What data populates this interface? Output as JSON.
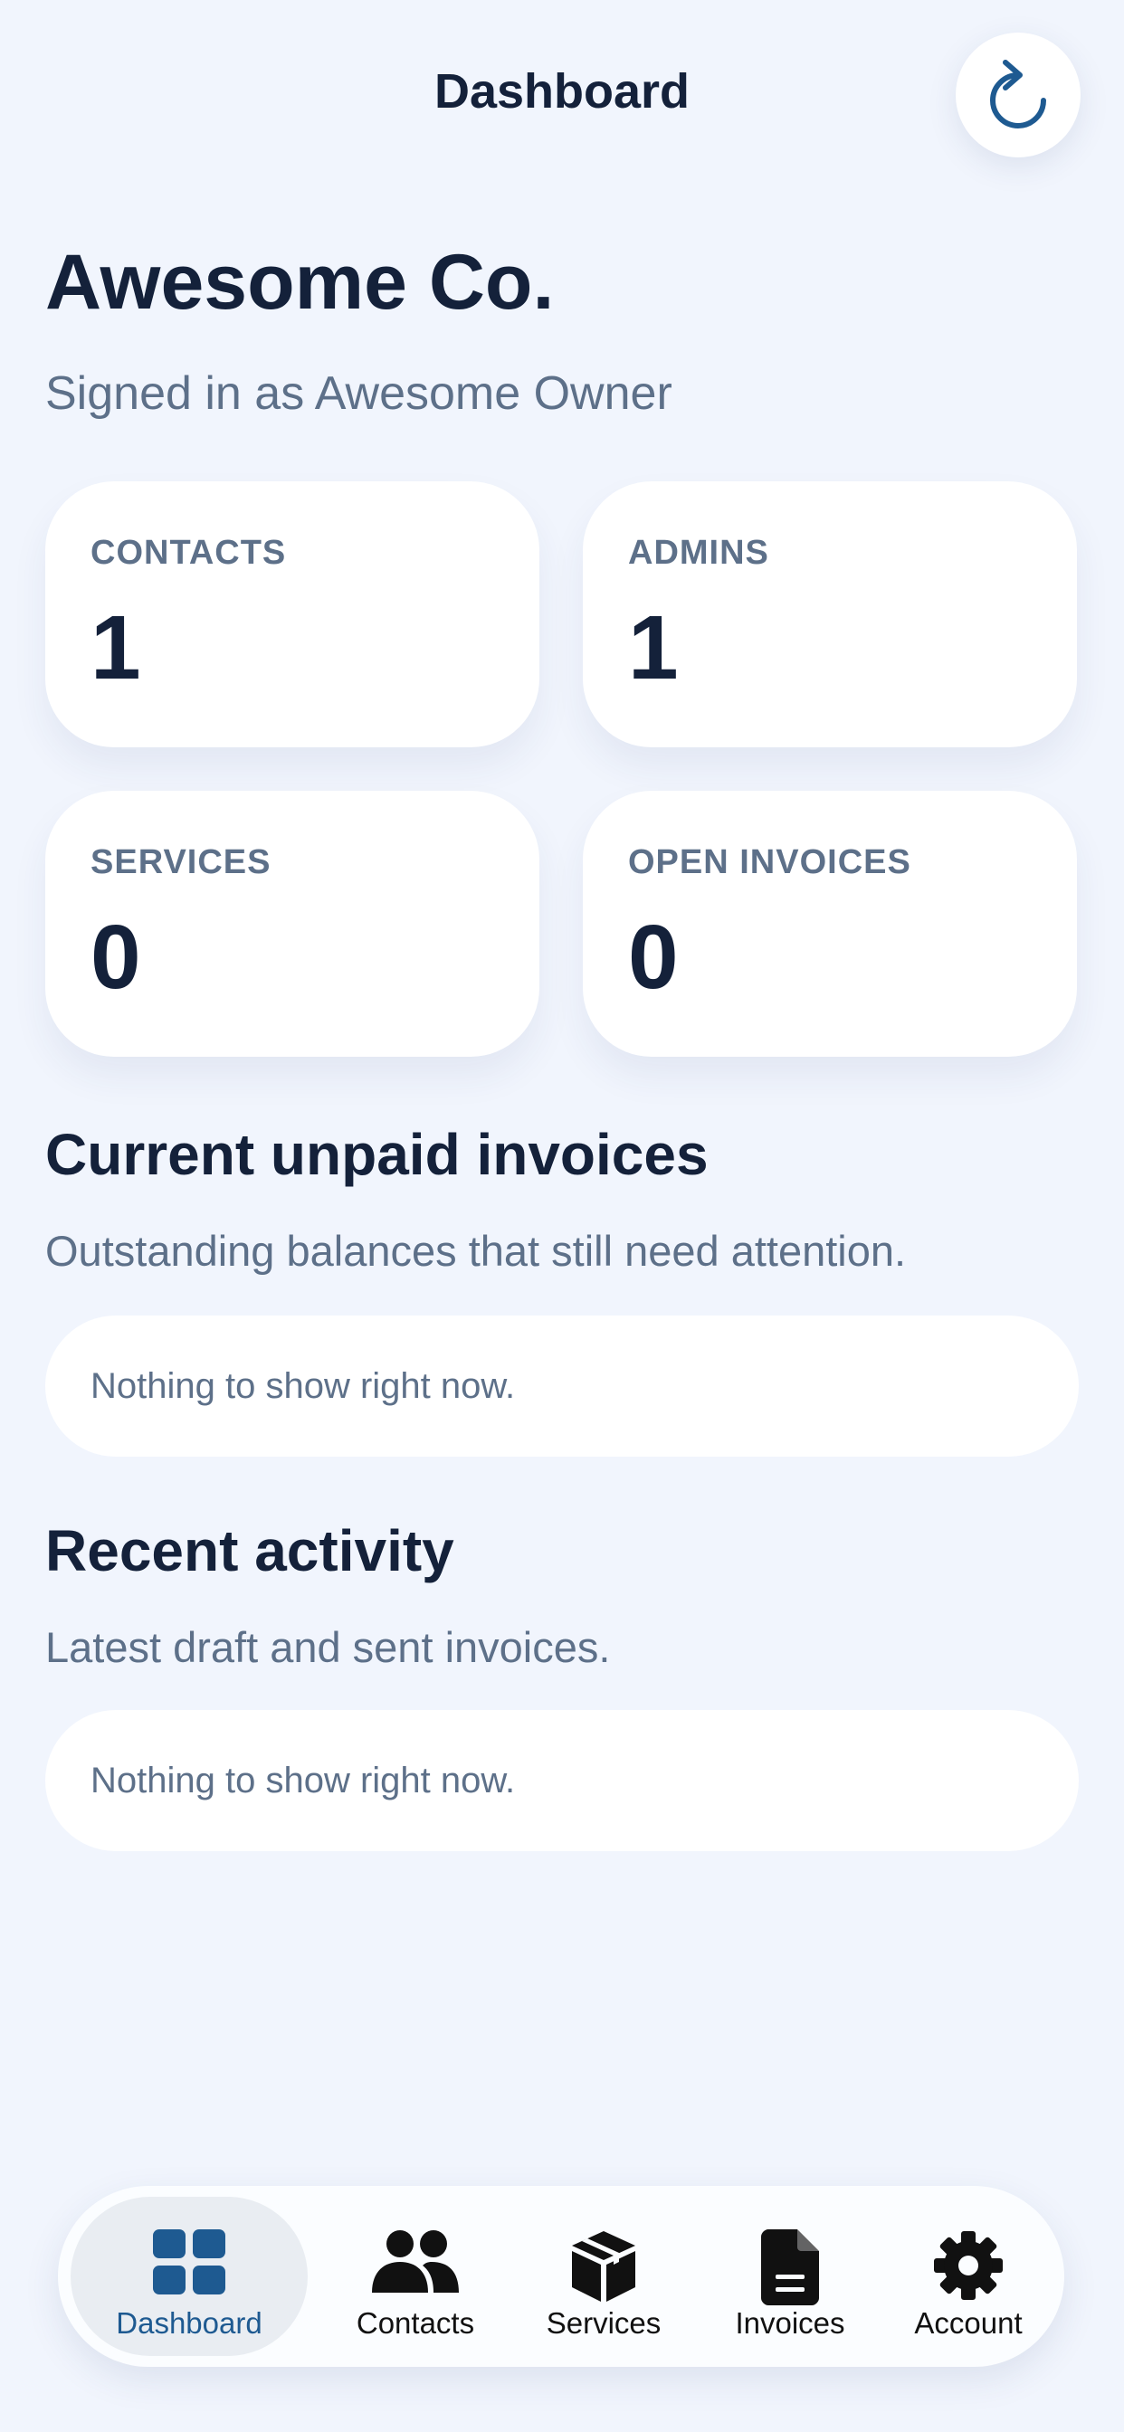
{
  "header": {
    "title": "Dashboard",
    "refresh_icon": "refresh-icon"
  },
  "company": {
    "name": "Awesome Co.",
    "signed_in": "Signed in as Awesome Owner"
  },
  "stats": [
    {
      "label": "CONTACTS",
      "value": "1"
    },
    {
      "label": "ADMINS",
      "value": "1"
    },
    {
      "label": "SERVICES",
      "value": "0"
    },
    {
      "label": "OPEN INVOICES",
      "value": "0"
    }
  ],
  "unpaid": {
    "title": "Current unpaid invoices",
    "subtitle": "Outstanding balances that still need attention.",
    "empty": "Nothing to show right now."
  },
  "activity": {
    "title": "Recent activity",
    "subtitle": "Latest draft and sent invoices.",
    "empty": "Nothing to show right now."
  },
  "tabs": [
    {
      "label": "Dashboard",
      "icon": "grid-icon",
      "active": true
    },
    {
      "label": "Contacts",
      "icon": "people-icon",
      "active": false
    },
    {
      "label": "Services",
      "icon": "box-icon",
      "active": false
    },
    {
      "label": "Invoices",
      "icon": "document-icon",
      "active": false
    },
    {
      "label": "Account",
      "icon": "gear-icon",
      "active": false
    }
  ],
  "colors": {
    "background": "#f1f5fd",
    "accent": "#1e5a91",
    "text_primary": "#14213a",
    "text_secondary": "#5d7089",
    "card": "#ffffff"
  }
}
